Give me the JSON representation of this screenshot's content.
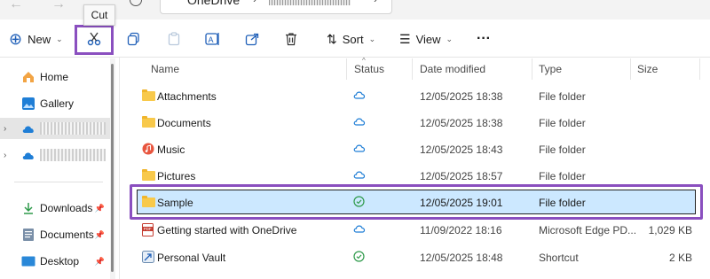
{
  "address": {
    "location": "OneDrive"
  },
  "tooltip": {
    "text": "Cut"
  },
  "toolbar": {
    "new_label": "New",
    "sort_label": "Sort",
    "view_label": "View"
  },
  "sidebar": {
    "items": [
      {
        "label": "Home",
        "icon": "home-icon"
      },
      {
        "label": "Gallery",
        "icon": "gallery-icon"
      },
      {
        "label": "",
        "icon": "cloud-icon"
      },
      {
        "label": "",
        "icon": "cloud-icon"
      },
      {
        "label": "Downloads",
        "icon": "download-icon"
      },
      {
        "label": "Documents",
        "icon": "documents-icon"
      },
      {
        "label": "Desktop",
        "icon": "desktop-icon"
      }
    ]
  },
  "columns": {
    "name": "Name",
    "status": "Status",
    "date": "Date modified",
    "type": "Type",
    "size": "Size"
  },
  "files": [
    {
      "name": "Attachments",
      "status": "cloud",
      "date": "12/05/2025 18:38",
      "type": "File folder",
      "size": "",
      "icon": "folder-icon"
    },
    {
      "name": "Documents",
      "status": "cloud",
      "date": "12/05/2025 18:38",
      "type": "File folder",
      "size": "",
      "icon": "folder-icon"
    },
    {
      "name": "Music",
      "status": "cloud",
      "date": "12/05/2025 18:43",
      "type": "File folder",
      "size": "",
      "icon": "music-folder-icon"
    },
    {
      "name": "Pictures",
      "status": "cloud",
      "date": "12/05/2025 18:57",
      "type": "File folder",
      "size": "",
      "icon": "folder-icon"
    },
    {
      "name": "Sample",
      "status": "synced",
      "date": "12/05/2025 19:01",
      "type": "File folder",
      "size": "",
      "icon": "folder-icon"
    },
    {
      "name": "Getting started with OneDrive",
      "status": "cloud",
      "date": "11/09/2022 18:16",
      "type": "Microsoft Edge PD...",
      "size": "1,029 KB",
      "icon": "pdf-icon"
    },
    {
      "name": "Personal Vault",
      "status": "synced",
      "date": "12/05/2025 18:48",
      "type": "Shortcut",
      "size": "2 KB",
      "icon": "vault-shortcut-icon"
    }
  ],
  "colors": {
    "accent": "#0067c0",
    "highlight": "#8a4fbf",
    "selection": "#cce8ff",
    "synced": "#2e9a4a",
    "folder": "#f8c94b"
  }
}
